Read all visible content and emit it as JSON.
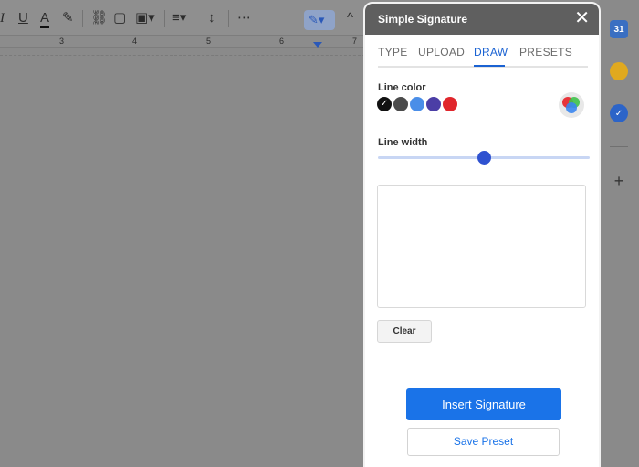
{
  "toolbar": {
    "items": [
      {
        "name": "italic-icon",
        "glyph": "I"
      },
      {
        "name": "underline-icon",
        "glyph": "U"
      },
      {
        "name": "text-color-icon",
        "glyph": "A"
      },
      {
        "name": "highlight-icon",
        "glyph": "✎"
      },
      {
        "name": "link-icon",
        "glyph": "⛓"
      },
      {
        "name": "comment-icon",
        "glyph": "▢"
      },
      {
        "name": "image-icon",
        "glyph": "▣▾"
      },
      {
        "name": "align-icon",
        "glyph": "≡▾"
      },
      {
        "name": "line-spacing-icon",
        "glyph": "↕"
      },
      {
        "name": "more-icon",
        "glyph": "⋯"
      }
    ],
    "pen_glyph": "✎▾",
    "collapse_glyph": "^"
  },
  "ruler": {
    "numbers": [
      "3",
      "4",
      "5",
      "6",
      "7"
    ]
  },
  "panel": {
    "title": "Simple Signature",
    "close_glyph": "✕",
    "tabs": [
      "TYPE",
      "UPLOAD",
      "DRAW",
      "PRESETS"
    ],
    "active_tab": "DRAW",
    "line_color_label": "Line color",
    "line_width_label": "Line width",
    "colors": [
      "#111111",
      "#4b4b4b",
      "#4a8ee8",
      "#4b3ea6",
      "#e0262c"
    ],
    "selected_color": "#111111",
    "check_glyph": "✓",
    "line_width_fraction": 0.5,
    "clear_label": "Clear",
    "insert_label": "Insert Signature",
    "save_preset_label": "Save Preset"
  },
  "colors": {
    "accent": "#1a73e8",
    "header": "#5f5f5f",
    "slider_thumb": "#2f52d0"
  }
}
